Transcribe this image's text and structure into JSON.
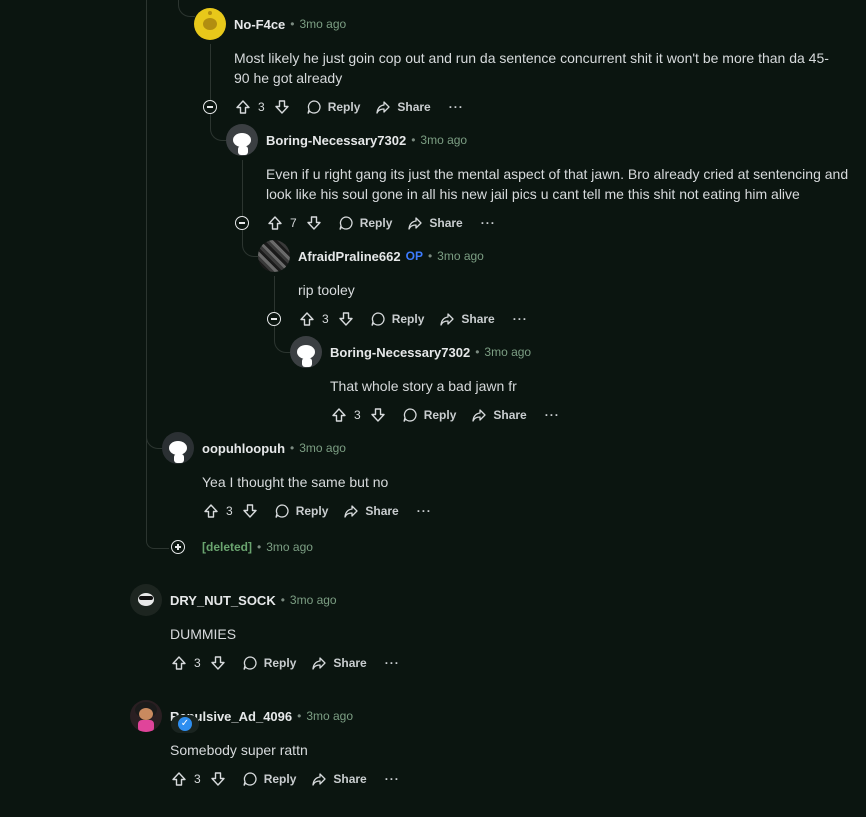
{
  "comments": [
    {
      "author": "No-F4ce",
      "time": "3mo ago",
      "text": "Most likely he just goin cop out and run da sentence concurrent shit it won't be more than da 45-90 he got already",
      "score": "3"
    },
    {
      "author": "Boring-Necessary7302",
      "time": "3mo ago",
      "text": "Even if u right gang its just the mental aspect of that jawn. Bro already cried at sentencing and look like his soul gone in all his new jail pics u cant tell me this shit not eating him alive",
      "score": "7"
    },
    {
      "author": "AfraidPraline662",
      "op": "OP",
      "time": "3mo ago",
      "text": "rip tooley",
      "score": "3"
    },
    {
      "author": "Boring-Necessary7302",
      "time": "3mo ago",
      "text": "That whole story a bad jawn fr",
      "score": "3"
    },
    {
      "author": "oopuhloopuh",
      "time": "3mo ago",
      "text": "Yea I thought the same but no",
      "score": "3"
    },
    {
      "author": "[deleted]",
      "time": "3mo ago"
    },
    {
      "author": "DRY_NUT_SOCK",
      "time": "3mo ago",
      "text": "DUMMIES",
      "score": "3"
    },
    {
      "author": "Repulsive_Ad_4096",
      "time": "3mo ago",
      "text": "Somebody super rattn",
      "score": "3"
    }
  ],
  "actions": {
    "reply": "Reply",
    "share": "Share",
    "more": "···"
  },
  "dot": "•",
  "colors": {
    "background": "#0b1510",
    "time": "#7c9e83",
    "op": "#3d7cff",
    "deleted": "#6aa46f"
  }
}
